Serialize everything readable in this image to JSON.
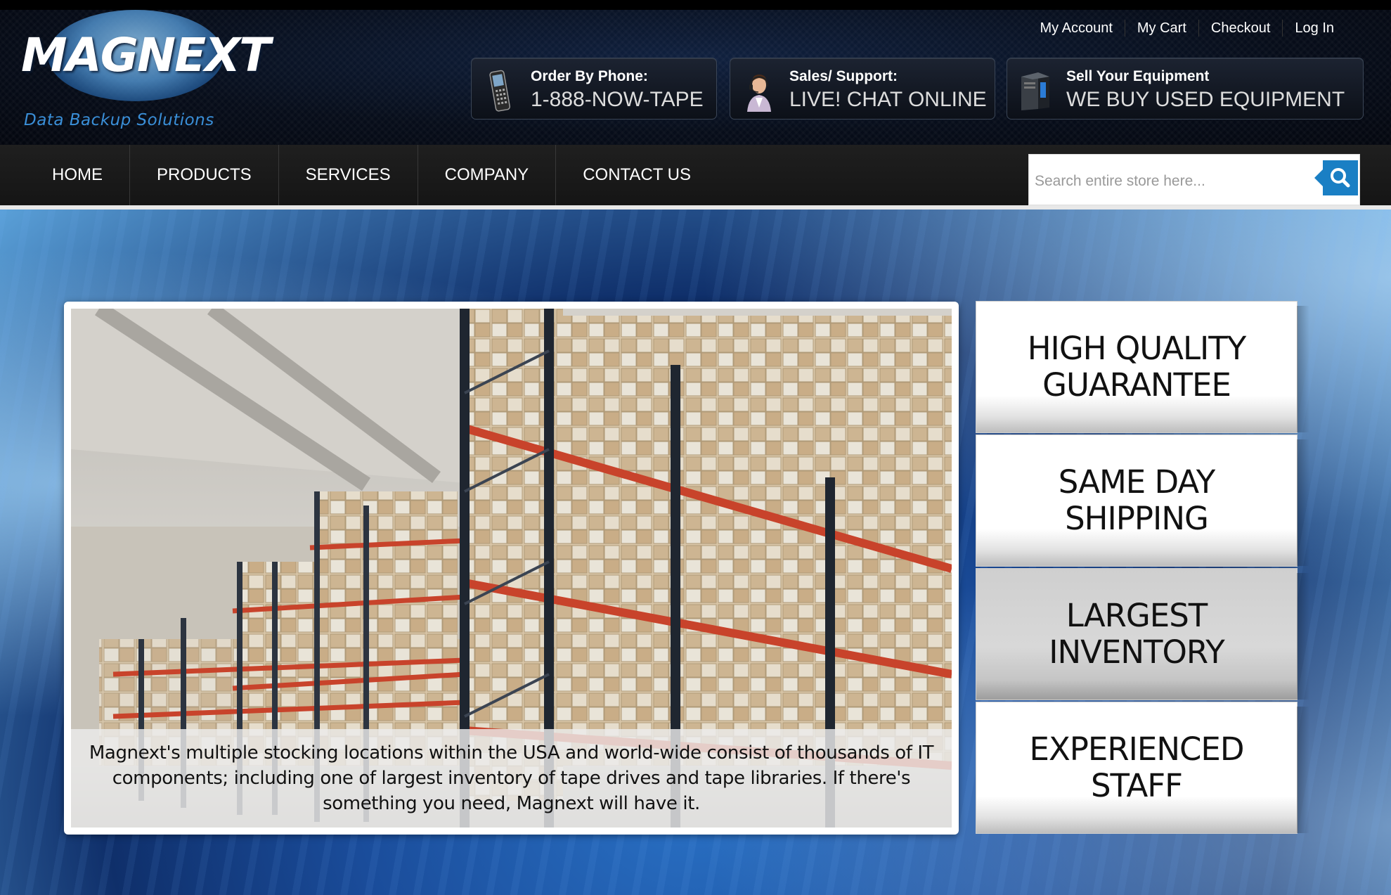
{
  "brand": {
    "name": "MAGNEXT",
    "tagline": "Data Backup Solutions"
  },
  "top_links": [
    "My Account",
    "My Cart",
    "Checkout",
    "Log In"
  ],
  "info_boxes": {
    "phone": {
      "label": "Order By Phone:",
      "value": "1-888-NOW-TAPE",
      "icon": "mobile-phone-icon"
    },
    "sales": {
      "label": "Sales/ Support:",
      "value": "LIVE! CHAT ONLINE",
      "icon": "support-agent-icon"
    },
    "sell": {
      "label": "Sell Your Equipment",
      "value": "WE BUY USED EQUIPMENT",
      "icon": "server-tower-icon"
    }
  },
  "nav": {
    "items": [
      "HOME",
      "PRODUCTS",
      "SERVICES",
      "COMPANY",
      "CONTACT US"
    ]
  },
  "search": {
    "placeholder": "Search entire store here...",
    "value": ""
  },
  "slider": {
    "caption": "Magnext's multiple stocking locations within the USA and world-wide consist of thousands of IT components; including one of largest inventory of tape drives and tape libraries. If there's something you need, Magnext will have it."
  },
  "features": [
    {
      "line1": "HIGH QUALITY",
      "line2": "GUARANTEE",
      "active": false
    },
    {
      "line1": "SAME DAY",
      "line2": "SHIPPING",
      "active": false
    },
    {
      "line1": "LARGEST",
      "line2": "INVENTORY",
      "active": true
    },
    {
      "line1": "EXPERIENCED",
      "line2": "STAFF",
      "active": false
    }
  ],
  "colors": {
    "accent_blue": "#1a7fc4",
    "header_bg": "#070d1a",
    "nav_bg": "#1a1a1a"
  }
}
